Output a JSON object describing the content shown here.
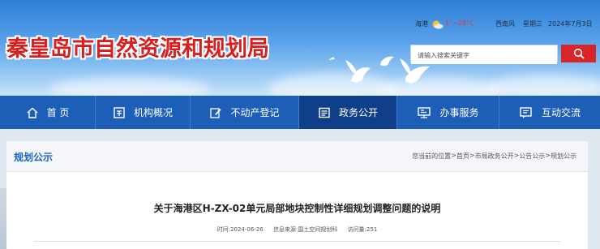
{
  "site": {
    "title": "秦皇岛市自然资源和规划局"
  },
  "topbar": {
    "weather_city": "海港",
    "weather_temp": "1°~28°C",
    "weather_wind": "西南风",
    "weekday": "星期三",
    "date": "2024年7月3日"
  },
  "search": {
    "placeholder": "请输入搜索关键字"
  },
  "nav": {
    "items": [
      {
        "label": "首 页",
        "icon": "home-icon"
      },
      {
        "label": "机构概况",
        "icon": "org-icon"
      },
      {
        "label": "不动产登记",
        "icon": "edit-icon"
      },
      {
        "label": "政务公开",
        "icon": "document-icon"
      },
      {
        "label": "办事服务",
        "icon": "service-icon"
      },
      {
        "label": "互动交流",
        "icon": "chat-icon"
      }
    ],
    "active_index": 3
  },
  "section": {
    "title": "规划公示"
  },
  "breadcrumb": {
    "prefix": "您当前的位置",
    "items": [
      "首页",
      "市局政务公开",
      "公告公示",
      "规划公示"
    ]
  },
  "article": {
    "title": "关于海港区H-ZX-02单元局部地块控制性详细规划调整问题的说明",
    "time_label": "时间:",
    "time": "2024-06-26",
    "source_label": "信息来源:",
    "source": "国土空间规划科",
    "views_label": "访问量:",
    "views": "251"
  },
  "colors": {
    "accent_red": "#d81e1e",
    "nav_blue": "#1d5fb6",
    "nav_active": "#0f3f88",
    "link_blue": "#1c64c2"
  }
}
